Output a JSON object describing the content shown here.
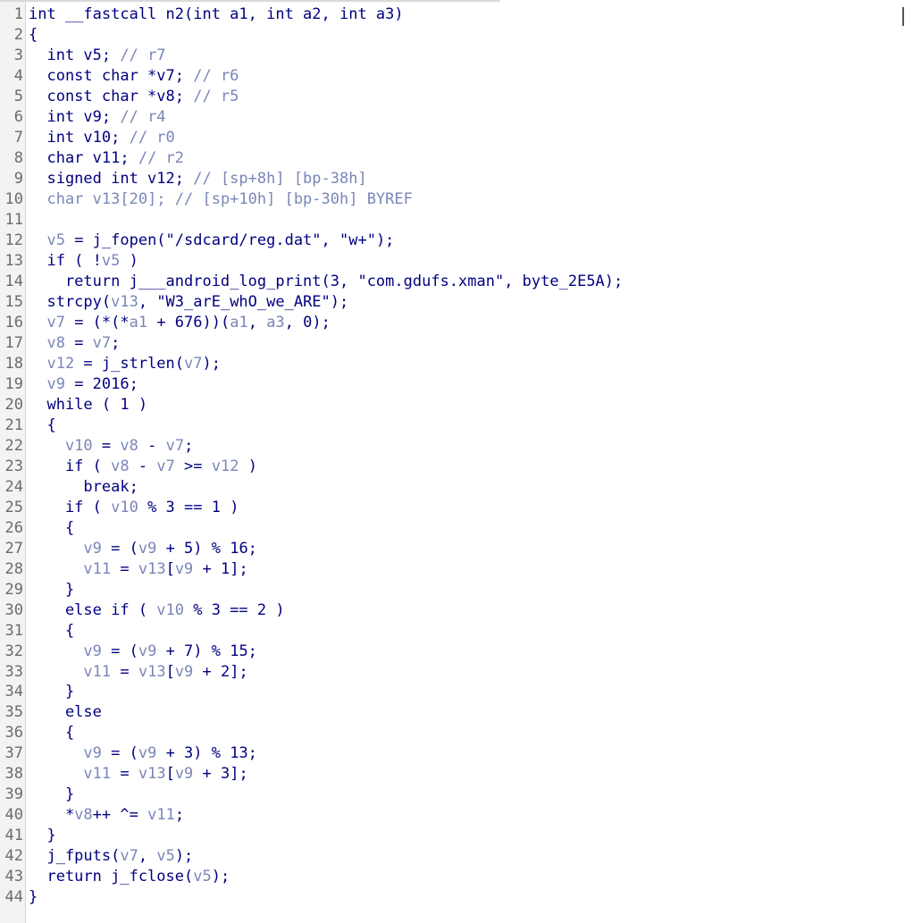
{
  "lines": [
    [
      [
        "n",
        "int __fastcall n2(int a1, int a2, int a3)"
      ]
    ],
    [
      [
        "n",
        "{"
      ]
    ],
    [
      [
        "n",
        "  int v5; "
      ],
      [
        "c",
        "// r7"
      ]
    ],
    [
      [
        "n",
        "  const char *v7; "
      ],
      [
        "c",
        "// r6"
      ]
    ],
    [
      [
        "n",
        "  const char *v8; "
      ],
      [
        "c",
        "// r5"
      ]
    ],
    [
      [
        "n",
        "  int v9; "
      ],
      [
        "c",
        "// r4"
      ]
    ],
    [
      [
        "n",
        "  int v10; "
      ],
      [
        "c",
        "// r0"
      ]
    ],
    [
      [
        "n",
        "  char v11; "
      ],
      [
        "c",
        "// r2"
      ]
    ],
    [
      [
        "n",
        "  signed int v12; "
      ],
      [
        "c",
        "// [sp+8h] [bp-38h]"
      ]
    ],
    [
      [
        "v",
        "  char v13[20]; "
      ],
      [
        "c",
        "// [sp+10h] [bp-30h] BYREF"
      ]
    ],
    [
      [
        "n",
        ""
      ]
    ],
    [
      [
        "v",
        "  v5"
      ],
      [
        "n",
        " = j_fopen(\"/sdcard/reg.dat\", \"w+\");"
      ]
    ],
    [
      [
        "n",
        "  if ( !"
      ],
      [
        "v",
        "v5"
      ],
      [
        "n",
        " )"
      ]
    ],
    [
      [
        "n",
        "    return j___android_log_print(3, \"com.gdufs.xman\", byte_2E5A);"
      ]
    ],
    [
      [
        "n",
        "  strcpy("
      ],
      [
        "v",
        "v13"
      ],
      [
        "n",
        ", \"W3_arE_whO_we_ARE\");"
      ]
    ],
    [
      [
        "v",
        "  v7"
      ],
      [
        "n",
        " = (*(*"
      ],
      [
        "v",
        "a1"
      ],
      [
        "n",
        " + 676))("
      ],
      [
        "v",
        "a1"
      ],
      [
        "n",
        ", "
      ],
      [
        "v",
        "a3"
      ],
      [
        "n",
        ", 0);"
      ]
    ],
    [
      [
        "v",
        "  v8"
      ],
      [
        "n",
        " = "
      ],
      [
        "v",
        "v7"
      ],
      [
        "n",
        ";"
      ]
    ],
    [
      [
        "v",
        "  v12"
      ],
      [
        "n",
        " = j_strlen("
      ],
      [
        "v",
        "v7"
      ],
      [
        "n",
        ");"
      ]
    ],
    [
      [
        "v",
        "  v9"
      ],
      [
        "n",
        " = 2016;"
      ]
    ],
    [
      [
        "n",
        "  while ( 1 )"
      ]
    ],
    [
      [
        "n",
        "  {"
      ]
    ],
    [
      [
        "v",
        "    v10"
      ],
      [
        "n",
        " = "
      ],
      [
        "v",
        "v8"
      ],
      [
        "n",
        " - "
      ],
      [
        "v",
        "v7"
      ],
      [
        "n",
        ";"
      ]
    ],
    [
      [
        "n",
        "    if ( "
      ],
      [
        "v",
        "v8"
      ],
      [
        "n",
        " - "
      ],
      [
        "v",
        "v7"
      ],
      [
        "n",
        " >= "
      ],
      [
        "v",
        "v12"
      ],
      [
        "n",
        " )"
      ]
    ],
    [
      [
        "n",
        "      break;"
      ]
    ],
    [
      [
        "n",
        "    if ( "
      ],
      [
        "v",
        "v10"
      ],
      [
        "n",
        " % 3 == 1 )"
      ]
    ],
    [
      [
        "n",
        "    {"
      ]
    ],
    [
      [
        "v",
        "      v9"
      ],
      [
        "n",
        " = ("
      ],
      [
        "v",
        "v9"
      ],
      [
        "n",
        " + 5) % 16;"
      ]
    ],
    [
      [
        "v",
        "      v11"
      ],
      [
        "n",
        " = "
      ],
      [
        "v",
        "v13"
      ],
      [
        "n",
        "["
      ],
      [
        "v",
        "v9"
      ],
      [
        "n",
        " + 1];"
      ]
    ],
    [
      [
        "n",
        "    }"
      ]
    ],
    [
      [
        "n",
        "    else if ( "
      ],
      [
        "v",
        "v10"
      ],
      [
        "n",
        " % 3 == 2 )"
      ]
    ],
    [
      [
        "n",
        "    {"
      ]
    ],
    [
      [
        "v",
        "      v9"
      ],
      [
        "n",
        " = ("
      ],
      [
        "v",
        "v9"
      ],
      [
        "n",
        " + 7) % 15;"
      ]
    ],
    [
      [
        "v",
        "      v11"
      ],
      [
        "n",
        " = "
      ],
      [
        "v",
        "v13"
      ],
      [
        "n",
        "["
      ],
      [
        "v",
        "v9"
      ],
      [
        "n",
        " + 2];"
      ]
    ],
    [
      [
        "n",
        "    }"
      ]
    ],
    [
      [
        "n",
        "    else"
      ]
    ],
    [
      [
        "n",
        "    {"
      ]
    ],
    [
      [
        "v",
        "      v9"
      ],
      [
        "n",
        " = ("
      ],
      [
        "v",
        "v9"
      ],
      [
        "n",
        " + 3) % 13;"
      ]
    ],
    [
      [
        "v",
        "      v11"
      ],
      [
        "n",
        " = "
      ],
      [
        "v",
        "v13"
      ],
      [
        "n",
        "["
      ],
      [
        "v",
        "v9"
      ],
      [
        "n",
        " + 3];"
      ]
    ],
    [
      [
        "n",
        "    }"
      ]
    ],
    [
      [
        "n",
        "    *"
      ],
      [
        "v",
        "v8"
      ],
      [
        "n",
        "++ ^= "
      ],
      [
        "v",
        "v11"
      ],
      [
        "n",
        ";"
      ]
    ],
    [
      [
        "n",
        "  }"
      ]
    ],
    [
      [
        "n",
        "  j_fputs("
      ],
      [
        "v",
        "v7"
      ],
      [
        "n",
        ", "
      ],
      [
        "v",
        "v5"
      ],
      [
        "n",
        ");"
      ]
    ],
    [
      [
        "n",
        "  return j_fclose("
      ],
      [
        "v",
        "v5"
      ],
      [
        "n",
        ");"
      ]
    ],
    [
      [
        "n",
        "}"
      ]
    ]
  ]
}
